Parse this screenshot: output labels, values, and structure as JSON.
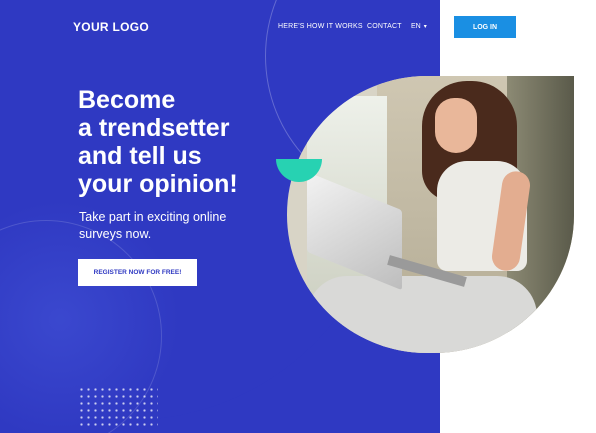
{
  "header": {
    "logo": "YOUR LOGO",
    "nav": [
      {
        "label": "HERE'S HOW IT WORKS"
      },
      {
        "label": "CONTACT"
      }
    ],
    "language": "EN",
    "login_label": "LOG IN"
  },
  "hero": {
    "headline_lines": [
      "Become",
      "a trendsetter",
      "and tell us",
      "your opinion!"
    ],
    "subtext_lines": [
      "Take part in exciting online",
      "surveys now."
    ],
    "register_label": "REGISTER NOW FOR FREE!"
  },
  "colors": {
    "primary_blue": "#2f39c2",
    "button_blue": "#1a8fe3",
    "accent_teal": "#27d2b2",
    "white": "#ffffff"
  },
  "icons": {
    "language_dropdown": "chevron-down-icon",
    "decoration": "dot-grid"
  }
}
